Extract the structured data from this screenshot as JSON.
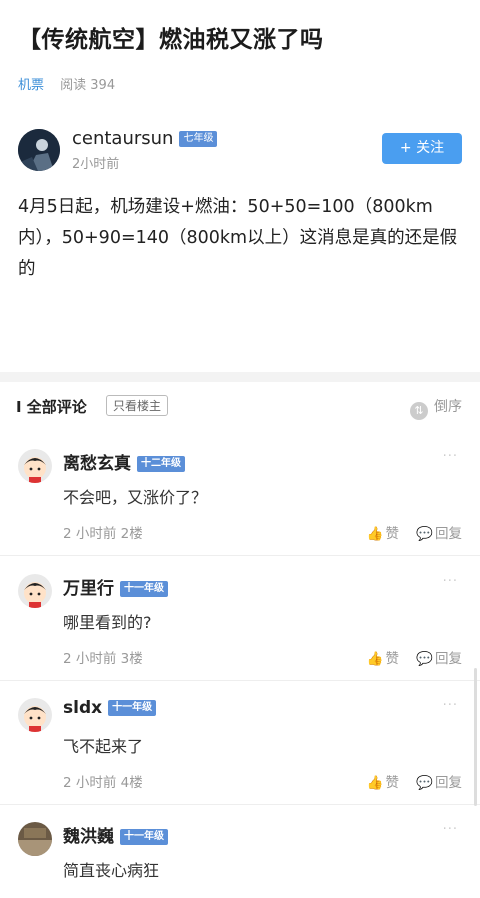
{
  "post": {
    "title": "【传统航空】燃油税又涨了吗",
    "category": "机票",
    "read": "阅读 394",
    "author": "centaursun",
    "author_level": "七年级",
    "time": "2小时前",
    "follow": "+ 关注",
    "body": "4月5日起，机场建设+燃油：50+50=100（800km内），50+90=140（800km以上）这消息是真的还是假的"
  },
  "comments_header": {
    "title": "I 全部评论",
    "only_host": "只看楼主",
    "order": "倒序"
  },
  "comments": [
    {
      "name": "离愁玄真",
      "level": "十二年级",
      "text": "不会吧，又涨价了？",
      "meta": "2 小时前  2楼",
      "like": "赞",
      "reply": "回复",
      "more": "···"
    },
    {
      "name": "万里行",
      "level": "十一年级",
      "text": "哪里看到的?",
      "meta": "2 小时前  3楼",
      "like": "赞",
      "reply": "回复",
      "more": "···"
    },
    {
      "name": "sldx",
      "level": "十一年级",
      "text": "飞不起来了",
      "meta": "2 小时前  4楼",
      "like": "赞",
      "reply": "回复",
      "more": "···"
    },
    {
      "name": "魏洪巍",
      "level": "十一年级",
      "text": "简直丧心病狂",
      "meta": "",
      "like": "",
      "reply": "",
      "more": "···"
    }
  ]
}
